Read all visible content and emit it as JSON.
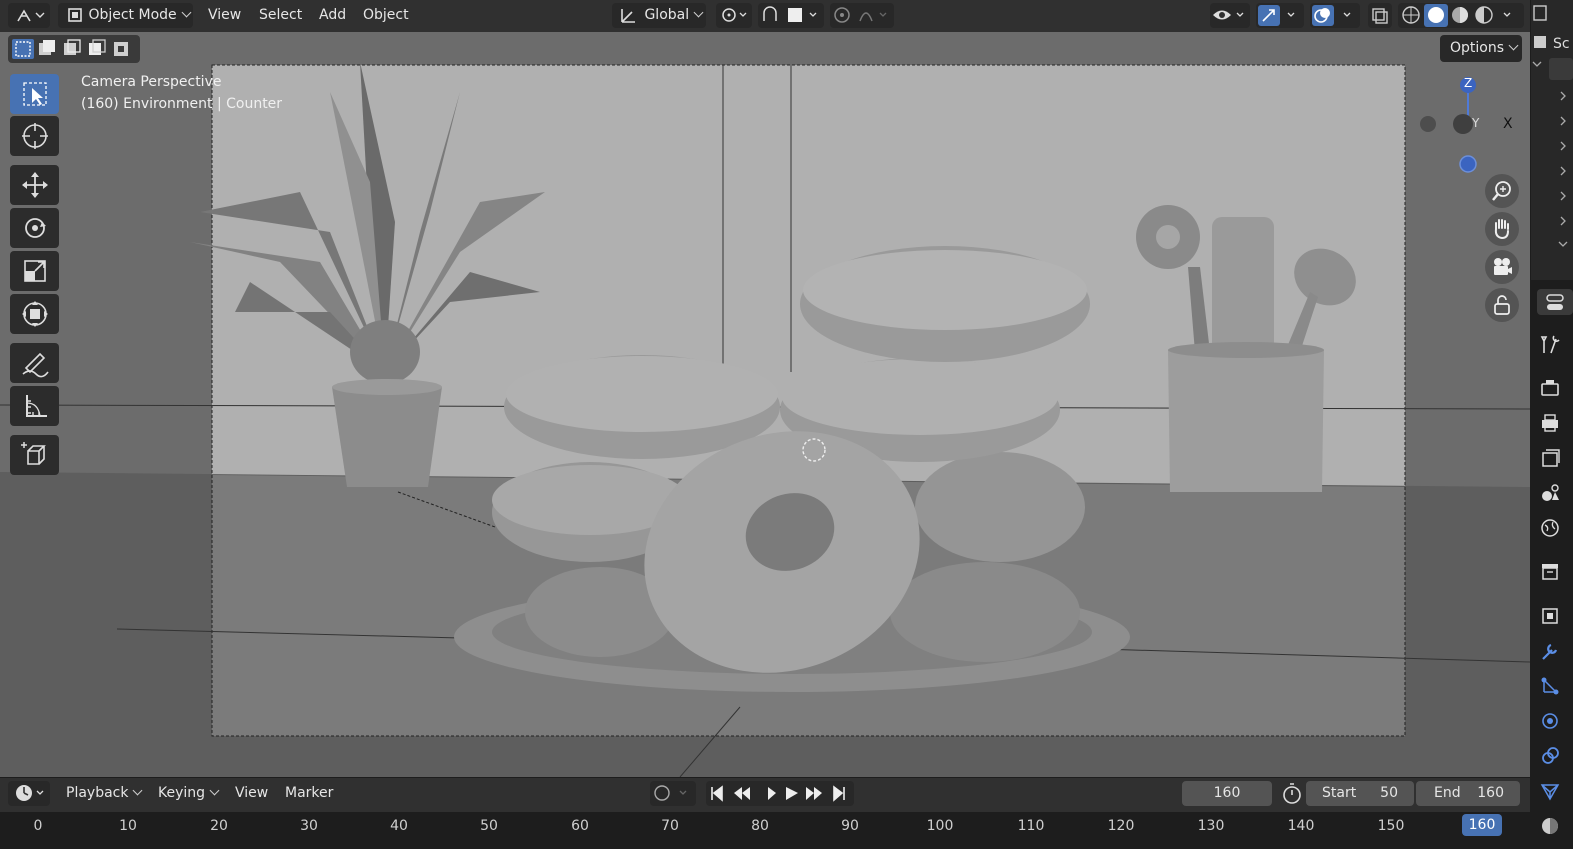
{
  "header": {
    "mode_label": "Object Mode",
    "menu": [
      "View",
      "Select",
      "Add",
      "Object"
    ],
    "orientation_label": "Global",
    "options_label": "Options"
  },
  "viewport": {
    "camera_label": "Camera Perspective",
    "context_label": "(160) Environment | Counter",
    "gizmo_z": "Z",
    "gizmo_x": "X",
    "gizmo_y": "Y"
  },
  "outliner": {
    "partial_label": "Sc"
  },
  "timeline": {
    "menu": [
      "Playback",
      "Keying",
      "View",
      "Marker"
    ],
    "current_frame": "160",
    "start_label": "Start",
    "start_value": "50",
    "end_label": "End",
    "end_value": "160",
    "ruler": [
      "0",
      "10",
      "20",
      "30",
      "40",
      "50",
      "60",
      "70",
      "80",
      "90",
      "100",
      "110",
      "120",
      "130",
      "140",
      "150"
    ],
    "ruler_current": "160"
  },
  "colors": {
    "accent": "#4772b3",
    "header_bg": "#303030",
    "viewport_bg": "#6c6c6c"
  },
  "icons": [
    "editor-type-icon",
    "object-mode-icon",
    "select-box-icon",
    "cursor-icon",
    "move-icon",
    "rotate-icon",
    "scale-icon",
    "transform-icon",
    "annotate-icon",
    "measure-icon",
    "add-cube-icon",
    "zoom-icon",
    "pan-hand-icon",
    "camera-view-icon",
    "lock-icon",
    "play-icon"
  ]
}
